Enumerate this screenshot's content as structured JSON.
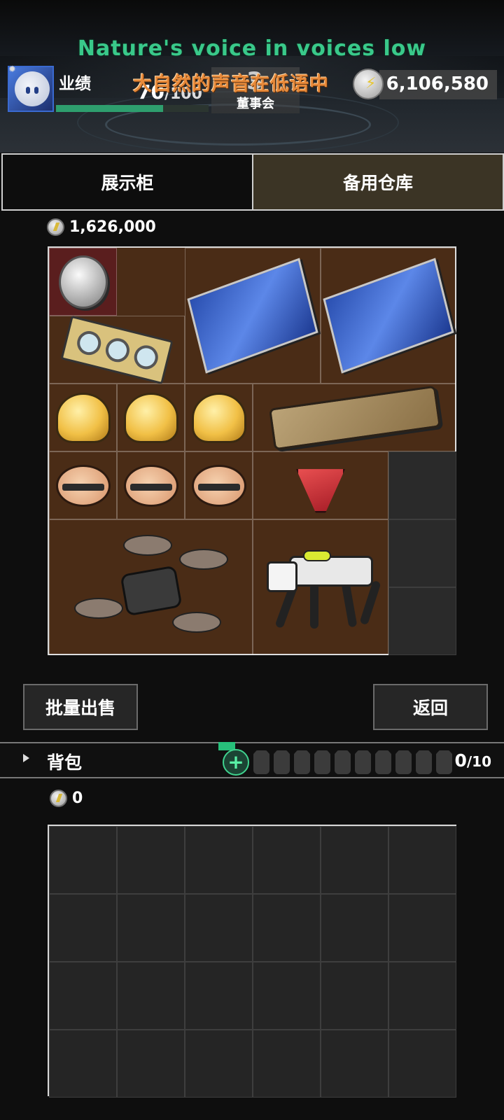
{
  "overlay": {
    "title_en": "Nature's voice in voices low",
    "title_zh": "大自然的声音在低语中"
  },
  "header": {
    "performance_label": "业绩",
    "performance_current": "70",
    "performance_max": "/100",
    "performance_progress": 0.7,
    "board_rank": "3",
    "board_label": "董事会",
    "money_total": "6,106,580",
    "icons": [
      "gear-icon",
      "avatar",
      "money-icon"
    ]
  },
  "tabs": [
    {
      "label": "展示柜",
      "active": false
    },
    {
      "label": "备用仓库",
      "active": true
    }
  ],
  "storage": {
    "value": "1,626,000",
    "grid_cols": 6,
    "grid_rows": 6,
    "items": [
      "coin",
      "graphics-card",
      "star-map",
      "star-map",
      "golden-bun",
      "golden-bun",
      "golden-bun",
      "smartphone",
      "toy-mask",
      "toy-mask",
      "toy-mask",
      "spinning-top",
      "drone",
      "robot-dog"
    ]
  },
  "buttons": {
    "bulk_sell": "批量出售",
    "back": "返回"
  },
  "backpack": {
    "label": "背包",
    "count": "0",
    "capacity": "/10",
    "value": "0",
    "locked_slots": 10,
    "grid_cols": 6,
    "grid_rows": 4
  },
  "colors": {
    "accent_green": "#39c98a",
    "storage_bg": "#4a2c16",
    "active_tab": "#3b3425",
    "subtitle_orange": "#e88a3a"
  }
}
